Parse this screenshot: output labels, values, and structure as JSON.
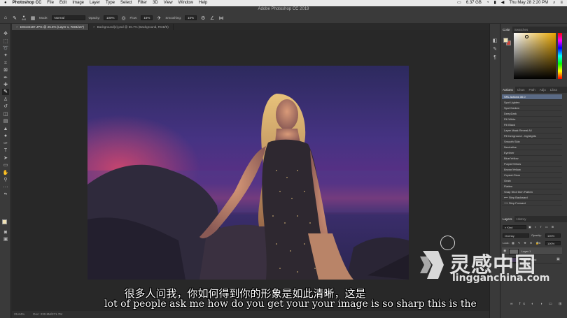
{
  "menubar": {
    "app_name": "Photoshop CC",
    "items": [
      "File",
      "Edit",
      "Image",
      "Layer",
      "Type",
      "Select",
      "Filter",
      "3D",
      "View",
      "Window",
      "Help"
    ],
    "status_size": "6.37 GB",
    "clock": "Thu May 28  2:20 PM"
  },
  "titlebar": {
    "title": "Adobe Photoshop CC 2019"
  },
  "options": {
    "brush_size": "444",
    "mode_label": "Mode:",
    "mode_value": "Normal",
    "opacity_label": "Opacity:",
    "opacity_value": "100%",
    "flow_label": "Flow:",
    "flow_value": "16%",
    "smoothing_label": "Smoothing:",
    "smoothing_value": "10%"
  },
  "tabs": [
    {
      "label": "DSC02187.JPG @ 25.6% (Layer 1, RGB/16*)",
      "active": true
    },
    {
      "label": "Background(2).psd @ 66.7% (Background, RGB/8)",
      "active": false
    }
  ],
  "statusbar": {
    "zoom": "25.64%",
    "doc": "Doc: 230.8M/371.7M"
  },
  "subtitles": {
    "cn": "很多人问我，你如何得到你的形象是如此清晰，这是",
    "en": "lot of people ask me how do you get your your image is so sharp this is the"
  },
  "color_panel": {
    "tabs": [
      "Color",
      "Swatches"
    ]
  },
  "actions_panel": {
    "tabs": [
      "Actions",
      "Chan",
      "Path",
      "Adju",
      "Libra"
    ],
    "items": [
      "SRL Actions 30.0",
      "Spot Lighten",
      "Spot Darken",
      "DeepDark",
      "Fill White",
      "Fill Black",
      "Layer Mask Reveal All",
      "Fill foreground - highlights",
      "Smooth Skin",
      "Neutralize",
      "Eyeliner",
      "Blue/Yellow",
      "Purple/Yellow",
      "Brown/Yellow",
      "Crystal Clear",
      "Grain",
      "Flatten",
      "Snap Shot then Flatten",
      "Step Backward",
      "Step Forward"
    ]
  },
  "layers_panel": {
    "tabs": [
      "Layers",
      "History"
    ],
    "kind_label": "Kind",
    "blend_mode": "Overlay",
    "opacity_label": "Opacity:",
    "opacity_value": "100%",
    "lock_label": "Lock:",
    "fill_label": "Fill:",
    "fill_value": "100%",
    "layers": [
      "Layer 1",
      "Background"
    ]
  },
  "watermark": {
    "cn": "灵感中国",
    "en": "lingganchina.com"
  },
  "colors": {
    "foreground": "#f0e2b5",
    "background": "#c6453b",
    "ui_dark": "#2b2b2b",
    "ui_panel": "#3a3a3a"
  }
}
